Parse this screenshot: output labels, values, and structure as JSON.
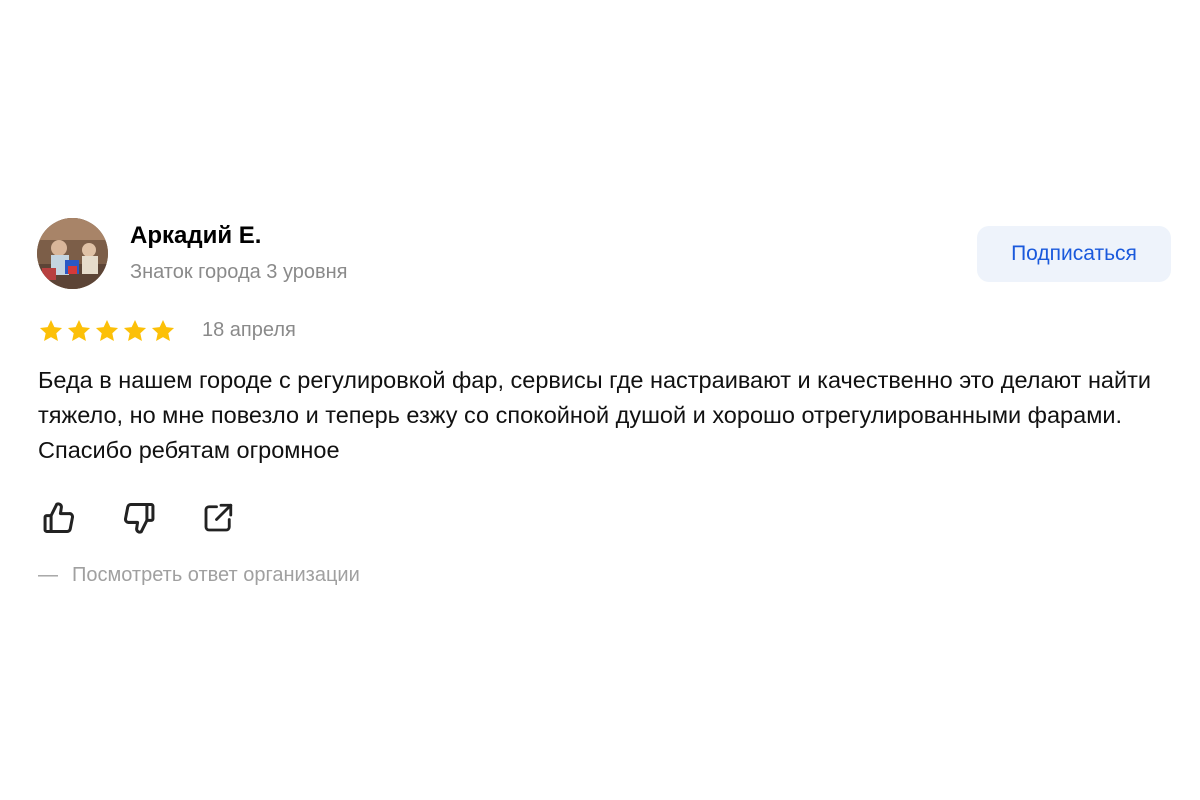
{
  "review": {
    "author": {
      "name": "Аркадий Е.",
      "level": "Знаток города 3 уровня"
    },
    "subscribe_label": "Подписаться",
    "rating": 5,
    "rating_max": 5,
    "date": "18 апреля",
    "text": "Беда в нашем городе с регулировкой фар, сервисы где настраивают и качественно это делают найти тяжело, но мне повезло и теперь езжу со спокойной душой и хорошо отрегулированными фарами. Спасибо ребятам огромное",
    "actions": {
      "like_icon": "thumbs-up-icon",
      "dislike_icon": "thumbs-down-icon",
      "share_icon": "share-icon"
    },
    "org_reply": {
      "dash": "—",
      "label": "Посмотреть ответ организации"
    }
  },
  "colors": {
    "accent": "#1a59dc",
    "button_bg": "#eef3fb",
    "star": "#fcc008",
    "muted_text": "#8a8a8a"
  }
}
